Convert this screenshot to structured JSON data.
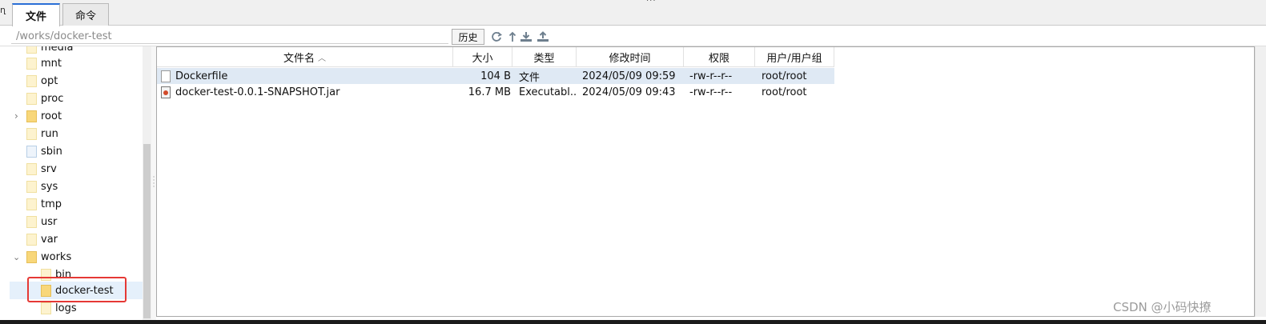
{
  "tabs": [
    {
      "label": "文件",
      "active": true
    },
    {
      "label": "命令",
      "active": false
    }
  ],
  "left_marker": "ղ",
  "top_dots": "···",
  "path": {
    "value": "/works/docker-test",
    "history_label": "历史"
  },
  "toolbar_icons": [
    "refresh-icon",
    "up-icon",
    "download-icon",
    "upload-icon"
  ],
  "tree": {
    "items": [
      {
        "label": "media",
        "indent": 0,
        "expanded": null
      },
      {
        "label": "mnt",
        "indent": 0,
        "expanded": null
      },
      {
        "label": "opt",
        "indent": 0,
        "expanded": null
      },
      {
        "label": "proc",
        "indent": 0,
        "expanded": null
      },
      {
        "label": "root",
        "indent": 0,
        "expanded": false
      },
      {
        "label": "run",
        "indent": 0,
        "expanded": null
      },
      {
        "label": "sbin",
        "indent": 0,
        "expanded": null
      },
      {
        "label": "srv",
        "indent": 0,
        "expanded": null
      },
      {
        "label": "sys",
        "indent": 0,
        "expanded": null
      },
      {
        "label": "tmp",
        "indent": 0,
        "expanded": null
      },
      {
        "label": "usr",
        "indent": 0,
        "expanded": null
      },
      {
        "label": "var",
        "indent": 0,
        "expanded": null
      },
      {
        "label": "works",
        "indent": 0,
        "expanded": true
      },
      {
        "label": "bin",
        "indent": 1,
        "expanded": null
      },
      {
        "label": "docker-test",
        "indent": 1,
        "expanded": null,
        "selected": true
      },
      {
        "label": "logs",
        "indent": 1,
        "expanded": null
      }
    ]
  },
  "files": {
    "columns": [
      "文件名",
      "大小",
      "类型",
      "修改时间",
      "权限",
      "用户/用户组"
    ],
    "sort_indicator": "^",
    "rows": [
      {
        "name": "Dockerfile",
        "size": "104 B",
        "type": "文件",
        "modified": "2024/05/09 09:59",
        "perms": "-rw-r--r--",
        "owner": "root/root",
        "icon": "file-icon",
        "selected": true
      },
      {
        "name": "docker-test-0.0.1-SNAPSHOT.jar",
        "size": "16.7 MB",
        "type": "Executabl...",
        "modified": "2024/05/09 09:43",
        "perms": "-rw-r--r--",
        "owner": "root/root",
        "icon": "jar-file-icon",
        "selected": false
      }
    ]
  },
  "watermark": "CSDN @小码快撩",
  "colors": {
    "tab_accent": "#2a6fd6",
    "highlight": "#e53935",
    "folder": "#f8d77a",
    "selection": "#dfe9f4"
  }
}
